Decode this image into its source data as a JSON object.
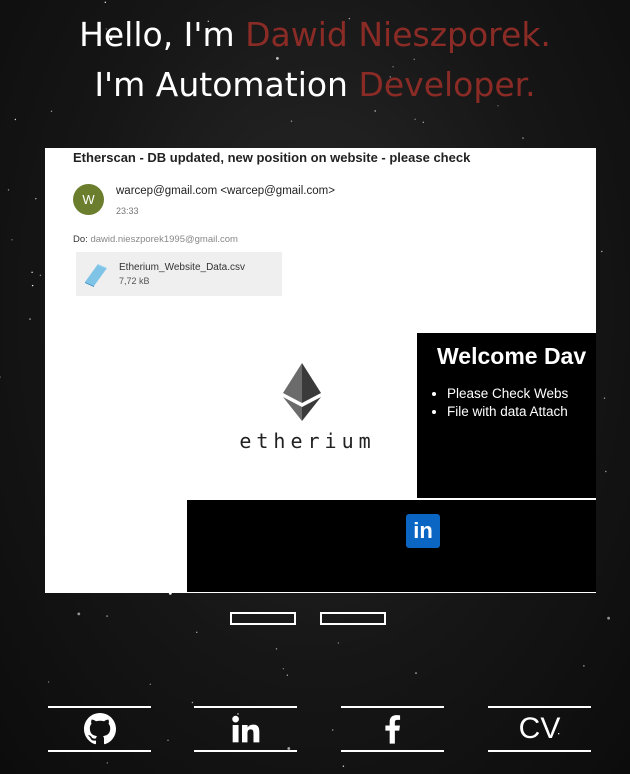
{
  "hero": {
    "line1_prefix": "Hello, I'm ",
    "line1_accent": "Dawid Nieszporek.",
    "line2_prefix": "I'm Automation ",
    "line2_accent": "Developer."
  },
  "colors": {
    "accent": "#8a2b26",
    "background": "#1a1a1a",
    "avatar": "#6b7e2d",
    "linkedin": "#0a66c2"
  },
  "slide": {
    "email": {
      "subject": "Etherscan - DB updated, new position on website - please check",
      "avatar_initial": "W",
      "from": "warcep@gmail.com <warcep@gmail.com>",
      "time": "23:33",
      "to_label": "Do:",
      "to_address": "dawid.nieszporek1995@gmail.com",
      "attachment_name": "Etherium_Website_Data.csv",
      "attachment_size": "7,72 kB"
    },
    "logo_text": "etherium",
    "welcome_title": "Welcome Dav",
    "welcome_items": [
      "Please Check Webs",
      "File with data Attach"
    ],
    "linkedin_text": "in"
  },
  "carousel": {
    "slide_count": 2,
    "active_index": 0
  },
  "social": {
    "github_icon": "github-icon",
    "linkedin_icon": "linkedin-icon",
    "facebook_icon": "facebook-icon",
    "cv_label": "CV"
  }
}
